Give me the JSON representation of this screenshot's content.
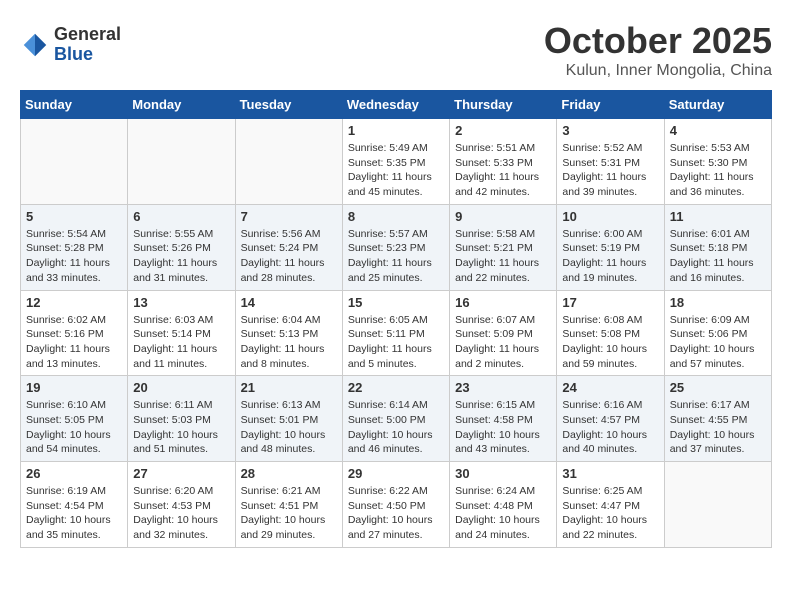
{
  "logo": {
    "general": "General",
    "blue": "Blue"
  },
  "title": "October 2025",
  "subtitle": "Kulun, Inner Mongolia, China",
  "days_header": [
    "Sunday",
    "Monday",
    "Tuesday",
    "Wednesday",
    "Thursday",
    "Friday",
    "Saturday"
  ],
  "weeks": [
    {
      "alt": false,
      "days": [
        {
          "num": "",
          "info": ""
        },
        {
          "num": "",
          "info": ""
        },
        {
          "num": "",
          "info": ""
        },
        {
          "num": "1",
          "info": "Sunrise: 5:49 AM\nSunset: 5:35 PM\nDaylight: 11 hours\nand 45 minutes."
        },
        {
          "num": "2",
          "info": "Sunrise: 5:51 AM\nSunset: 5:33 PM\nDaylight: 11 hours\nand 42 minutes."
        },
        {
          "num": "3",
          "info": "Sunrise: 5:52 AM\nSunset: 5:31 PM\nDaylight: 11 hours\nand 39 minutes."
        },
        {
          "num": "4",
          "info": "Sunrise: 5:53 AM\nSunset: 5:30 PM\nDaylight: 11 hours\nand 36 minutes."
        }
      ]
    },
    {
      "alt": true,
      "days": [
        {
          "num": "5",
          "info": "Sunrise: 5:54 AM\nSunset: 5:28 PM\nDaylight: 11 hours\nand 33 minutes."
        },
        {
          "num": "6",
          "info": "Sunrise: 5:55 AM\nSunset: 5:26 PM\nDaylight: 11 hours\nand 31 minutes."
        },
        {
          "num": "7",
          "info": "Sunrise: 5:56 AM\nSunset: 5:24 PM\nDaylight: 11 hours\nand 28 minutes."
        },
        {
          "num": "8",
          "info": "Sunrise: 5:57 AM\nSunset: 5:23 PM\nDaylight: 11 hours\nand 25 minutes."
        },
        {
          "num": "9",
          "info": "Sunrise: 5:58 AM\nSunset: 5:21 PM\nDaylight: 11 hours\nand 22 minutes."
        },
        {
          "num": "10",
          "info": "Sunrise: 6:00 AM\nSunset: 5:19 PM\nDaylight: 11 hours\nand 19 minutes."
        },
        {
          "num": "11",
          "info": "Sunrise: 6:01 AM\nSunset: 5:18 PM\nDaylight: 11 hours\nand 16 minutes."
        }
      ]
    },
    {
      "alt": false,
      "days": [
        {
          "num": "12",
          "info": "Sunrise: 6:02 AM\nSunset: 5:16 PM\nDaylight: 11 hours\nand 13 minutes."
        },
        {
          "num": "13",
          "info": "Sunrise: 6:03 AM\nSunset: 5:14 PM\nDaylight: 11 hours\nand 11 minutes."
        },
        {
          "num": "14",
          "info": "Sunrise: 6:04 AM\nSunset: 5:13 PM\nDaylight: 11 hours\nand 8 minutes."
        },
        {
          "num": "15",
          "info": "Sunrise: 6:05 AM\nSunset: 5:11 PM\nDaylight: 11 hours\nand 5 minutes."
        },
        {
          "num": "16",
          "info": "Sunrise: 6:07 AM\nSunset: 5:09 PM\nDaylight: 11 hours\nand 2 minutes."
        },
        {
          "num": "17",
          "info": "Sunrise: 6:08 AM\nSunset: 5:08 PM\nDaylight: 10 hours\nand 59 minutes."
        },
        {
          "num": "18",
          "info": "Sunrise: 6:09 AM\nSunset: 5:06 PM\nDaylight: 10 hours\nand 57 minutes."
        }
      ]
    },
    {
      "alt": true,
      "days": [
        {
          "num": "19",
          "info": "Sunrise: 6:10 AM\nSunset: 5:05 PM\nDaylight: 10 hours\nand 54 minutes."
        },
        {
          "num": "20",
          "info": "Sunrise: 6:11 AM\nSunset: 5:03 PM\nDaylight: 10 hours\nand 51 minutes."
        },
        {
          "num": "21",
          "info": "Sunrise: 6:13 AM\nSunset: 5:01 PM\nDaylight: 10 hours\nand 48 minutes."
        },
        {
          "num": "22",
          "info": "Sunrise: 6:14 AM\nSunset: 5:00 PM\nDaylight: 10 hours\nand 46 minutes."
        },
        {
          "num": "23",
          "info": "Sunrise: 6:15 AM\nSunset: 4:58 PM\nDaylight: 10 hours\nand 43 minutes."
        },
        {
          "num": "24",
          "info": "Sunrise: 6:16 AM\nSunset: 4:57 PM\nDaylight: 10 hours\nand 40 minutes."
        },
        {
          "num": "25",
          "info": "Sunrise: 6:17 AM\nSunset: 4:55 PM\nDaylight: 10 hours\nand 37 minutes."
        }
      ]
    },
    {
      "alt": false,
      "days": [
        {
          "num": "26",
          "info": "Sunrise: 6:19 AM\nSunset: 4:54 PM\nDaylight: 10 hours\nand 35 minutes."
        },
        {
          "num": "27",
          "info": "Sunrise: 6:20 AM\nSunset: 4:53 PM\nDaylight: 10 hours\nand 32 minutes."
        },
        {
          "num": "28",
          "info": "Sunrise: 6:21 AM\nSunset: 4:51 PM\nDaylight: 10 hours\nand 29 minutes."
        },
        {
          "num": "29",
          "info": "Sunrise: 6:22 AM\nSunset: 4:50 PM\nDaylight: 10 hours\nand 27 minutes."
        },
        {
          "num": "30",
          "info": "Sunrise: 6:24 AM\nSunset: 4:48 PM\nDaylight: 10 hours\nand 24 minutes."
        },
        {
          "num": "31",
          "info": "Sunrise: 6:25 AM\nSunset: 4:47 PM\nDaylight: 10 hours\nand 22 minutes."
        },
        {
          "num": "",
          "info": ""
        }
      ]
    }
  ]
}
